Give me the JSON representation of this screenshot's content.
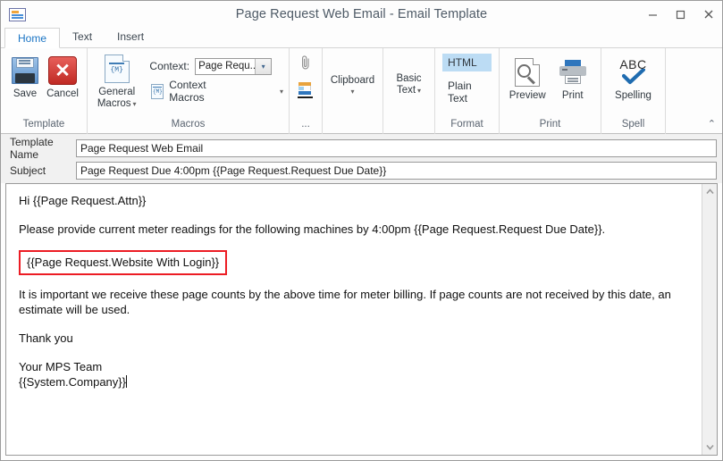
{
  "window": {
    "title": "Page Request Web Email - Email Template",
    "icon": "email-template-icon",
    "minimize": "–",
    "maximize": "▫",
    "close": "✖"
  },
  "tabs": [
    {
      "label": "Home",
      "active": true
    },
    {
      "label": "Text",
      "active": false
    },
    {
      "label": "Insert",
      "active": false
    }
  ],
  "ribbon": {
    "groups": [
      {
        "name": "template",
        "label": "Template",
        "buttons": [
          {
            "label": "Save",
            "icon": "floppy-disk-icon"
          },
          {
            "label": "Cancel",
            "icon": "red-x-icon"
          }
        ]
      },
      {
        "name": "macros",
        "label": "Macros",
        "buttons": [
          {
            "label": "General Macros",
            "icon": "macro-document-icon",
            "caret": "▾"
          }
        ],
        "context_label": "Context:",
        "context_value": "Page Requ...",
        "context_arrow": "▾",
        "context_macros_label": "Context Macros",
        "context_macros_caret": "▾",
        "context_macros_icon": "macro-small-document-icon"
      },
      {
        "name": "attachments",
        "label": "...",
        "icons": [
          "paperclip-icon",
          "paste-icon"
        ]
      },
      {
        "name": "clipboard",
        "label": "",
        "buttons": [
          {
            "label": "Clipboard",
            "caret": "▾"
          }
        ]
      },
      {
        "name": "basic-text",
        "label": "",
        "buttons": [
          {
            "label": "Basic Text",
            "caret": "▾"
          }
        ]
      },
      {
        "name": "format",
        "label": "Format",
        "options": [
          {
            "label": "HTML",
            "selected": true
          },
          {
            "label": "Plain Text",
            "selected": false
          }
        ]
      },
      {
        "name": "print",
        "label": "Print",
        "buttons": [
          {
            "label": "Preview",
            "icon": "magnifier-page-icon"
          },
          {
            "label": "Print",
            "icon": "printer-icon"
          }
        ]
      },
      {
        "name": "spell",
        "label": "Spell",
        "buttons": [
          {
            "label": "Spelling",
            "icon": "abc-checkmark-icon",
            "icon_text": "ABC"
          }
        ]
      }
    ],
    "collapse_arrow": "⌃"
  },
  "fields": [
    {
      "name": "template-name",
      "label": "Template Name",
      "value": "Page Request Web Email",
      "placeholder": ""
    },
    {
      "name": "subject",
      "label": "Subject",
      "value": "Page Request Due 4:00pm {{Page Request.Request Due Date}}",
      "placeholder": ""
    }
  ],
  "editor": {
    "line_greeting": "Hi {{Page Request.Attn}}",
    "line_instruction": "Please provide current meter readings for the following machines by 4:00pm {{Page Request.Request Due Date}}.",
    "highlighted_macro": "{{Page Request.Website With Login}}",
    "line_important": "It is important we receive these page counts by the above time for meter billing. If page counts are not received by this date, an estimate will be used.",
    "line_thanks": "Thank you",
    "line_signature": "Your MPS Team",
    "line_company": "{{System.Company}}",
    "highlight_border_color": "#ec1c24"
  },
  "scrollbar": {
    "up_arrow": "⌃",
    "down_arrow": "⌄"
  },
  "colors": {
    "accent": "#1a74c4",
    "selected_fill": "#bcdcf4",
    "alert": "#ec1c24"
  }
}
